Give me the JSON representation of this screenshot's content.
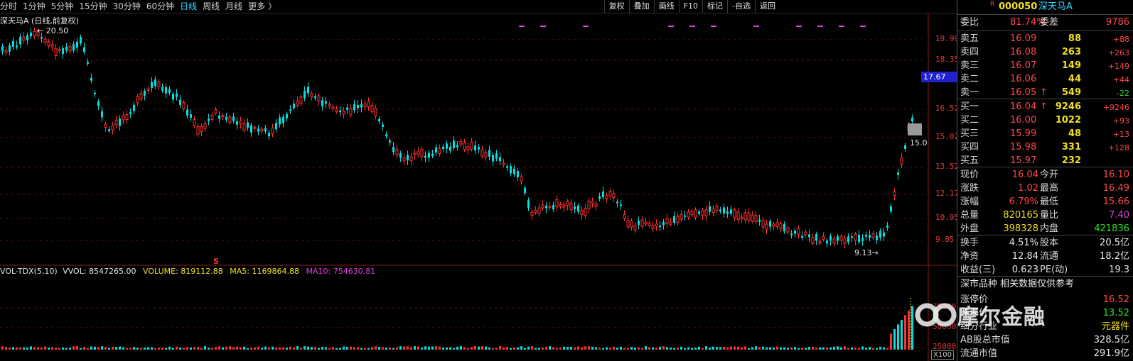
{
  "periods": [
    "分时",
    "1分钟",
    "5分钟",
    "15分钟",
    "30分钟",
    "60分钟",
    "日线",
    "周线",
    "月线",
    "更多 〉"
  ],
  "active_period": "日线",
  "tool_buttons": [
    "复权",
    "叠加",
    "画线",
    "F10",
    "标记",
    "-自选",
    "返回"
  ],
  "chart_title": "深天马A (日线,前复权)",
  "high_label": "20.50",
  "low_label": "9.13",
  "price_ticks": [
    "19.99",
    "18.35",
    "16.52",
    "15.02",
    "13.52",
    "12.17",
    "10.95",
    "9.85"
  ],
  "current_price_tag": "17.67",
  "last_price_tag": "15.0",
  "vol_indicator": {
    "name": "VOL-TDX(5,10)",
    "vvol": "VVOL: 8547265.00",
    "volume": "VOLUME: 819112.88",
    "ma5": "MA5: 1169864.88",
    "ma10": "MA10: 754630.81"
  },
  "vol_ticks": [
    "75000",
    "50000",
    "25000"
  ],
  "vol_unit": "X100",
  "marker_s": "S",
  "watermark": "摩尔金融",
  "stock": {
    "code": "000050",
    "name": "深天马A",
    "flag": "R",
    "weibi_label": "委比",
    "weibi": "81.74%",
    "weicha_label": "委差",
    "weicha": "9786",
    "asks": [
      {
        "label": "卖五",
        "price": "16.09",
        "vol": "88",
        "chg": "+88"
      },
      {
        "label": "卖四",
        "price": "16.08",
        "vol": "263",
        "chg": "+263"
      },
      {
        "label": "卖三",
        "price": "16.07",
        "vol": "149",
        "chg": "+149"
      },
      {
        "label": "卖二",
        "price": "16.06",
        "vol": "44",
        "chg": "+44"
      },
      {
        "label": "卖一",
        "price": "16.05",
        "vol": "549",
        "chg": "-22",
        "arrow": "↑"
      }
    ],
    "bids": [
      {
        "label": "买一",
        "price": "16.04",
        "vol": "9246",
        "chg": "+9246",
        "arrow": "↑"
      },
      {
        "label": "买二",
        "price": "16.00",
        "vol": "1022",
        "chg": "+93"
      },
      {
        "label": "买三",
        "price": "15.99",
        "vol": "48",
        "chg": "+13"
      },
      {
        "label": "买四",
        "price": "15.98",
        "vol": "331",
        "chg": "+128"
      },
      {
        "label": "买五",
        "price": "15.97",
        "vol": "232",
        "chg": ""
      }
    ],
    "quote": [
      {
        "l1": "现价",
        "v1": "16.04",
        "l2": "今开",
        "v2": "16.10"
      },
      {
        "l1": "涨跌",
        "v1": "1.02",
        "l2": "最高",
        "v2": "16.49"
      },
      {
        "l1": "涨幅",
        "v1": "6.79%",
        "l2": "最低",
        "v2": "15.66"
      },
      {
        "l1": "总量",
        "v1": "820165",
        "l2": "量比",
        "v2": "7.40"
      },
      {
        "l1": "外盘",
        "v1": "398328",
        "l2": "内盘",
        "v2": "421836"
      }
    ],
    "fin": [
      {
        "l1": "换手",
        "v1": "4.51%",
        "l2": "股本",
        "v2": "20.5亿"
      },
      {
        "l1": "净资",
        "v1": "12.84",
        "l2": "流通",
        "v2": "18.2亿"
      },
      {
        "l1": "收益(三)",
        "v1": "0.623",
        "l2": "PE(动)",
        "v2": "19.3"
      }
    ],
    "section_title": "深市品种  相关数据仅供参考",
    "extra": [
      {
        "l": "涨停价",
        "v": "16.52"
      },
      {
        "l": "跌停价",
        "v": "13.52"
      },
      {
        "l": "细分行业",
        "v": "元器件"
      },
      {
        "l": "AB股总市值",
        "v": "328.5亿"
      },
      {
        "l": "流通市值",
        "v": "291.9亿"
      }
    ]
  },
  "colors": {
    "up": "#ff3030",
    "down": "#00e0e0",
    "axis": "#e03a3a",
    "accent": "#33d6ff",
    "tag": "#2020d0"
  }
}
